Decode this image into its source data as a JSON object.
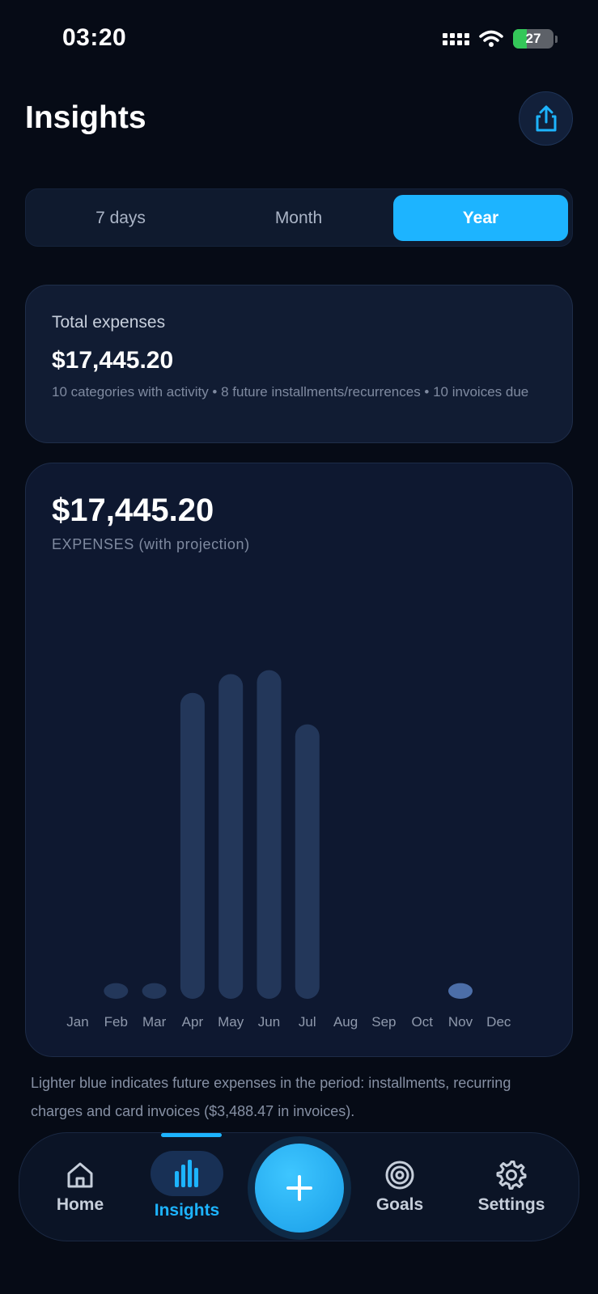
{
  "status_bar": {
    "time": "03:20",
    "battery": "27"
  },
  "header": {
    "title": "Insights"
  },
  "segments": [
    {
      "label": "7 days",
      "active": false
    },
    {
      "label": "Month",
      "active": false
    },
    {
      "label": "Year",
      "active": true
    }
  ],
  "summary": {
    "label": "Total expenses",
    "value": "$17,445.20",
    "meta": "10 categories with activity • 8 future installments/recurrences • 10 invoices due"
  },
  "chart_header": {
    "value": "$17,445.20",
    "subtitle": "EXPENSES (with projection)"
  },
  "chart_data": {
    "type": "bar",
    "categories": [
      "Jan",
      "Feb",
      "Mar",
      "Apr",
      "May",
      "Jun",
      "Jul",
      "Aug",
      "Sep",
      "Oct",
      "Nov",
      "Dec"
    ],
    "series": [
      {
        "values": [
          0,
          40,
          40,
          780,
          828,
          838,
          700,
          0,
          0,
          0,
          40,
          0
        ]
      }
    ],
    "highlight_category": "Nov",
    "ylim": [
      0,
      860
    ],
    "grid": false,
    "colors": {
      "bar": "#23375a",
      "future_bar": "#4c6ea8"
    }
  },
  "footnote": "Lighter blue indicates future expenses in the period: installments, recurring charges and card invoices ($3,488.47 in invoices).",
  "nav": {
    "home": "Home",
    "insights": "Insights",
    "goals": "Goals",
    "settings": "Settings"
  },
  "icons": {
    "share": "share-icon",
    "add": "plus-icon",
    "home": "home-icon",
    "insights": "bar-chart-icon",
    "goals": "target-icon",
    "settings": "gear-icon"
  },
  "colors": {
    "accent": "#1db4ff",
    "background": "#060b16",
    "card": "#111c33"
  }
}
